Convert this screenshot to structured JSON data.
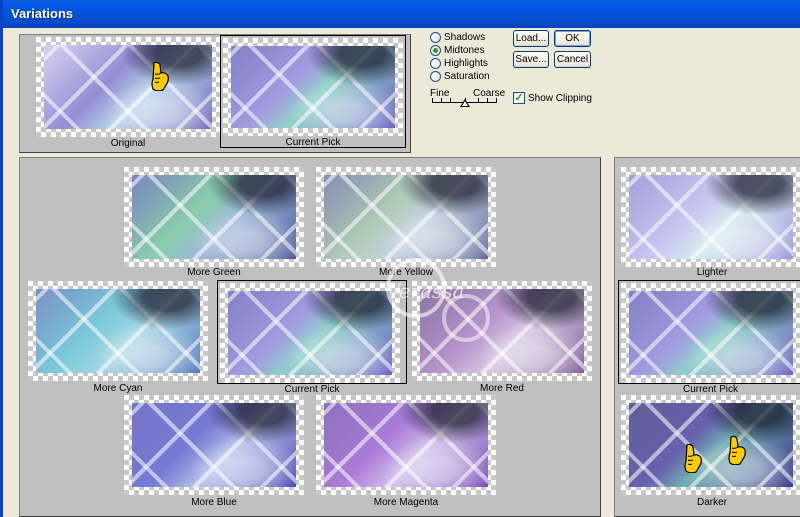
{
  "window": {
    "title": "Variations"
  },
  "thumbs": {
    "original": "Original",
    "current_pick_top": "Current Pick",
    "more_green": "More Green",
    "more_yellow": "More Yellow",
    "more_cyan": "More Cyan",
    "current_pick_center": "Current Pick",
    "more_red": "More Red",
    "more_blue": "More Blue",
    "more_magenta": "More Magenta",
    "lighter": "Lighter",
    "current_pick_right": "Current Pick",
    "darker": "Darker"
  },
  "tone_options": [
    {
      "label": "Shadows",
      "selected": false
    },
    {
      "label": "Midtones",
      "selected": true
    },
    {
      "label": "Highlights",
      "selected": false
    },
    {
      "label": "Saturation",
      "selected": false
    }
  ],
  "slider": {
    "fine_label": "Fine",
    "coarse_label": "Coarse",
    "position": 0.5
  },
  "show_clipping": {
    "label": "Show Clipping",
    "checked": true,
    "check_glyph": "✓"
  },
  "buttons": {
    "load": "Load...",
    "ok": "OK",
    "save": "Save...",
    "cancel": "Cancel"
  },
  "watermark_text": "Verassa",
  "colors": {
    "green": "#7fc9a6",
    "yellow": "#d6e2b4",
    "cyan": "#6fc6d8",
    "red": "#b08ac8",
    "blue": "#6b6fd0",
    "magenta": "#a470d4",
    "base": "#9c93d8"
  }
}
